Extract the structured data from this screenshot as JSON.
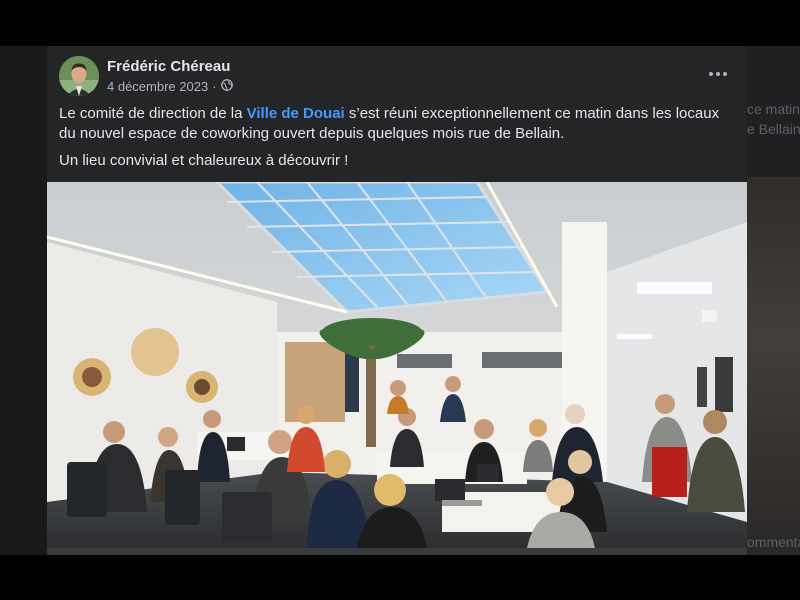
{
  "post": {
    "author": "Frédéric Chéreau",
    "date": "4 décembre 2023",
    "date_sep": "·",
    "audience_icon": "globe-icon",
    "more_icon": "more-options-icon",
    "text_before_link": "Le comité de direction de la ",
    "link_text": "Ville de Douai",
    "text_after_link": " s’est réuni exceptionnellement ce matin dans les locaux du nouvel espace de coworking ouvert depuis quelques mois rue de Bellain.",
    "line2": "Un lieu convivial et chaleureux à découvrir !"
  },
  "background": {
    "ghost_line1": "ce matin",
    "ghost_line2": "e Bellain.",
    "ghost_bottom": "ommentair"
  },
  "colors": {
    "card": "#242526",
    "text": "#e4e6eb",
    "secondary": "#b0b3b8",
    "link": "#4599ff"
  }
}
